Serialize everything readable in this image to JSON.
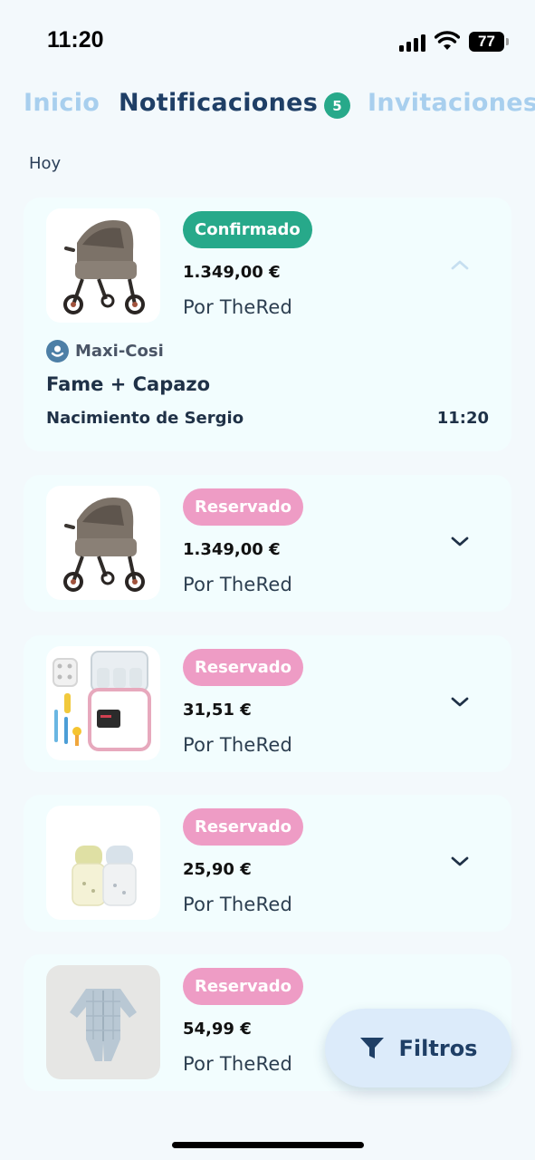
{
  "status_bar": {
    "time": "11:20",
    "battery": "77"
  },
  "tabs": [
    {
      "label": "Inicio"
    },
    {
      "label": "Notificaciones",
      "badge": "5"
    },
    {
      "label": "Invitaciones"
    }
  ],
  "section": {
    "label": "Hoy"
  },
  "notifications": [
    {
      "status": "Confirmado",
      "status_color": "#27a98a",
      "price": "1.349,00 €",
      "seller": "Por TheRed",
      "expanded": true,
      "image": "stroller",
      "brand": "Maxi-Cosi",
      "product": "Fame + Capazo",
      "event": "Nacimiento de Sergio",
      "time": "11:20"
    },
    {
      "status": "Reservado",
      "status_color": "#ee9cc5",
      "price": "1.349,00 €",
      "seller": "Por TheRed",
      "expanded": false,
      "image": "stroller"
    },
    {
      "status": "Reservado",
      "status_color": "#ee9cc5",
      "price": "31,51 €",
      "seller": "Por TheRed",
      "expanded": false,
      "image": "bottle-sterilizer"
    },
    {
      "status": "Reservado",
      "status_color": "#ee9cc5",
      "price": "25,90 €",
      "seller": "Por TheRed",
      "expanded": false,
      "image": "baby-bottles"
    },
    {
      "status": "Reservado",
      "status_color": "#ee9cc5",
      "price": "54,99 €",
      "seller": "Por TheRed",
      "expanded": false,
      "image": "baby-sleepsuit"
    }
  ],
  "filter_button": {
    "label": "Filtros",
    "icon": "filter-icon"
  }
}
